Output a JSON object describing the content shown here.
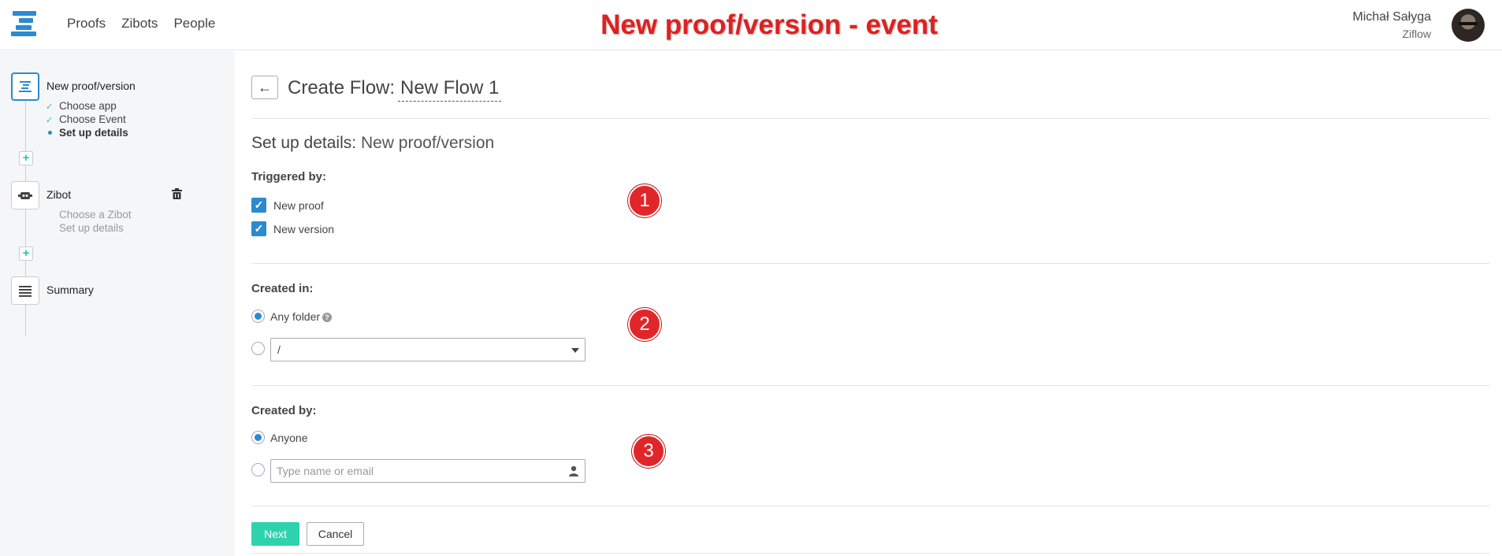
{
  "header": {
    "nav": [
      "Proofs",
      "Zibots",
      "People"
    ],
    "annotation_title": "New proof/version - event",
    "user_name": "Michał Sałyga",
    "user_org": "Ziflow"
  },
  "sidebar": {
    "steps": [
      {
        "title": "New proof/version",
        "substeps": [
          "Choose app",
          "Choose Event",
          "Set up details"
        ]
      },
      {
        "title": "Zibot",
        "substeps": [
          "Choose a Zibot",
          "Set up details"
        ]
      },
      {
        "title": "Summary"
      }
    ],
    "plus_glyph": "+"
  },
  "main": {
    "back_glyph": "←",
    "create_flow_label": "Create Flow:",
    "flow_name": "New Flow 1",
    "setup_label": "Set up details:",
    "setup_value": "New proof/version",
    "triggered_by": {
      "label": "Triggered by:",
      "options": [
        "New proof",
        "New version"
      ],
      "checked": [
        true,
        true
      ]
    },
    "created_in": {
      "label": "Created in:",
      "any_label": "Any folder",
      "help_glyph": "?",
      "folder_value": "/"
    },
    "created_by": {
      "label": "Created by:",
      "any_label": "Anyone",
      "placeholder": "Type name or email"
    },
    "badges": [
      "1",
      "2",
      "3"
    ],
    "next_label": "Next",
    "cancel_label": "Cancel",
    "check_glyph": "✓"
  },
  "colors": {
    "accent_blue": "#2a8bd0",
    "accent_green": "#2ed3ad",
    "annotation_red": "#e1262b"
  }
}
